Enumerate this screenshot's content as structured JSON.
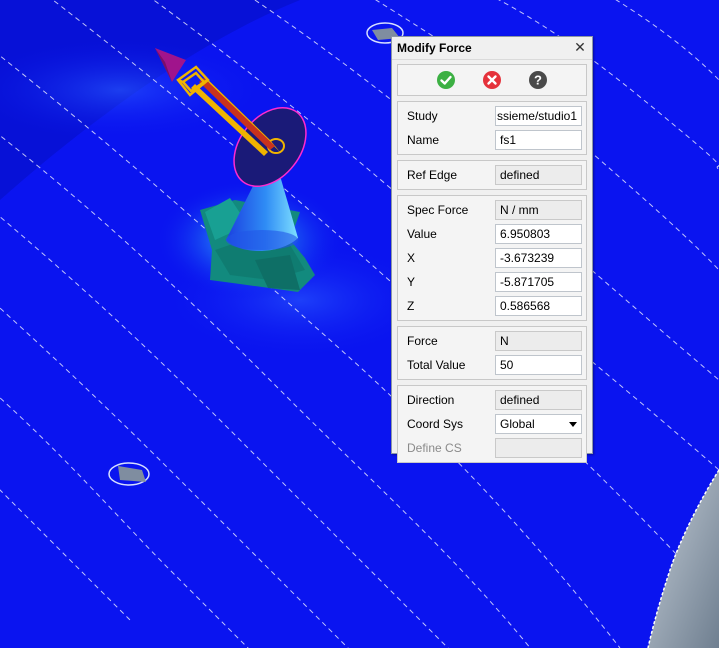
{
  "dialog": {
    "title": "Modify Force",
    "close_glyph": "✕",
    "actions": [
      {
        "icon": "check-icon",
        "color": "#3cb043"
      },
      {
        "icon": "cancel-icon",
        "color": "#e5323b"
      },
      {
        "icon": "help-icon",
        "color": "#4a4a4a"
      }
    ],
    "study": {
      "label": "Study",
      "value": "ssieme/studio1"
    },
    "name": {
      "label": "Name",
      "value": "fs1"
    },
    "ref_edge": {
      "label": "Ref Edge",
      "value": "defined"
    },
    "spec_force": {
      "label": "Spec Force",
      "value": "N / mm"
    },
    "value": {
      "label": "Value",
      "value": "6.950803"
    },
    "x": {
      "label": "X",
      "value": "-3.673239"
    },
    "y": {
      "label": "Y",
      "value": "-5.871705"
    },
    "z": {
      "label": "Z",
      "value": "0.586568"
    },
    "force": {
      "label": "Force",
      "value": "N"
    },
    "total_value": {
      "label": "Total Value",
      "value": "50"
    },
    "direction": {
      "label": "Direction",
      "value": "defined"
    },
    "coord_sys": {
      "label": "Coord Sys",
      "value": "Global"
    },
    "define_cs": {
      "label": "Define CS",
      "value": ""
    }
  },
  "colors": {
    "model_blue": "#0a14f0",
    "arrow_shaft": "#c8321e",
    "arrow_frame": "#f0b400",
    "arrow_head": "#a0148c",
    "cone": "#1e6ef0",
    "base": "#148c82"
  }
}
